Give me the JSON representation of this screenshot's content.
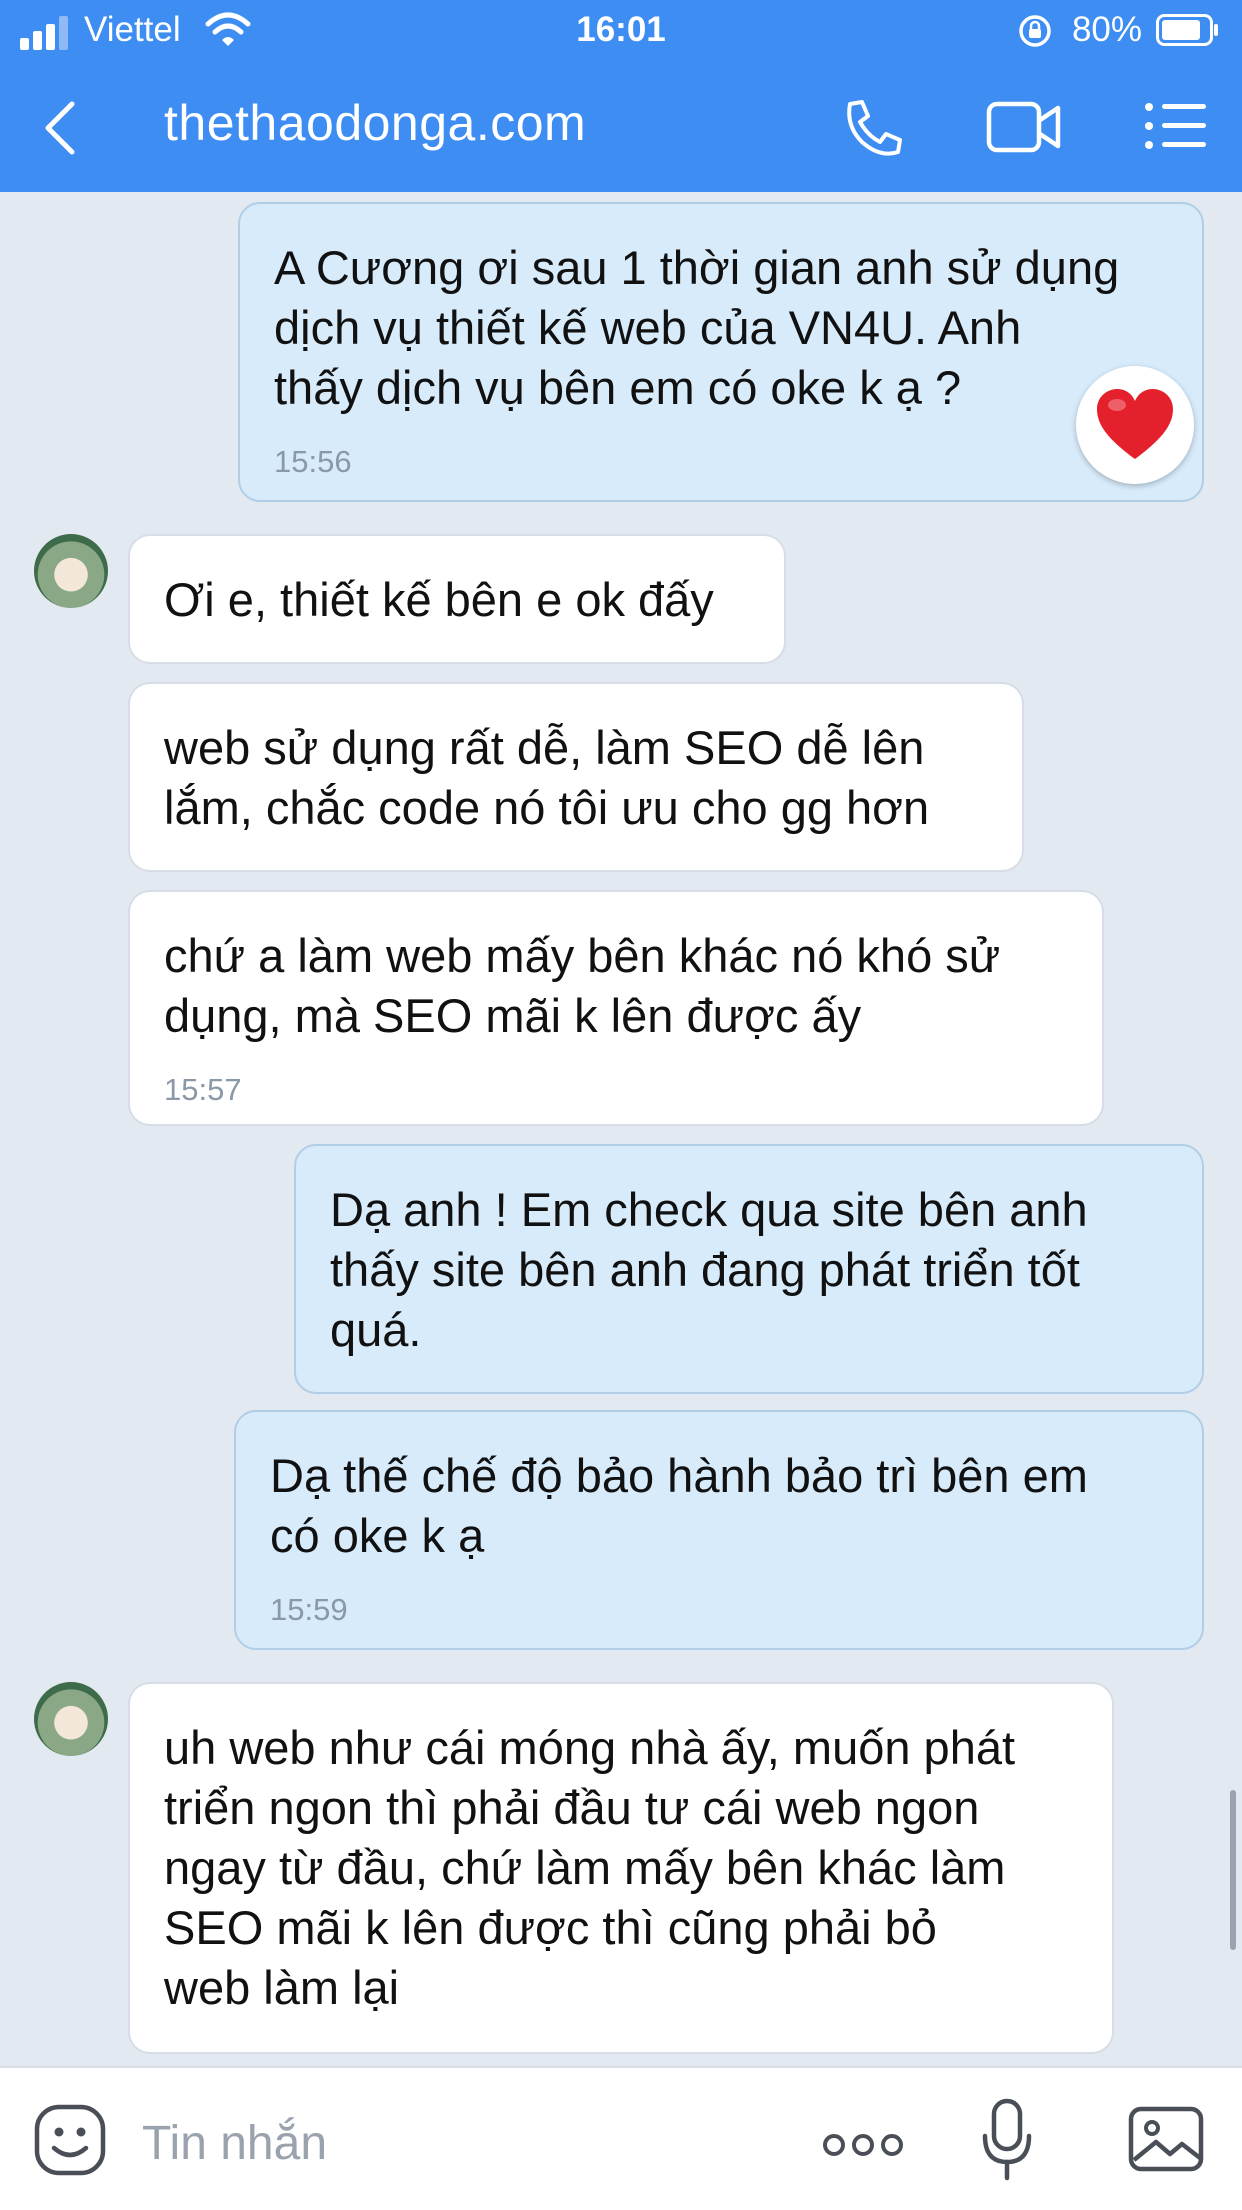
{
  "status_bar": {
    "carrier": "Viettel",
    "time": "16:01",
    "battery": "80%"
  },
  "header": {
    "title": "thethaodonga.com"
  },
  "messages": [
    {
      "dir": "out",
      "text": "A Cương ơi sau 1 thời gian anh sử dụng\ndịch vụ thiết kế web của VN4U. Anh\nthấy dịch vụ bên em có oke k ạ ?",
      "time": "15:56",
      "reaction": "heart"
    },
    {
      "dir": "in",
      "text": "Ơi e, thiết kế bên e ok đấy",
      "time": ""
    },
    {
      "dir": "in",
      "text": "web sử dụng rất dễ, làm SEO dễ lên\nlắm, chắc code nó tôi ưu cho gg hơn",
      "time": ""
    },
    {
      "dir": "in",
      "text": "chứ a làm web mấy bên khác nó khó sử\ndụng, mà SEO mãi k lên được ấy",
      "time": "15:57"
    },
    {
      "dir": "out",
      "text": "Dạ anh ! Em check qua site bên anh\nthấy site bên anh đang phát triển tốt\nquá.",
      "time": ""
    },
    {
      "dir": "out",
      "text": "Dạ thế chế độ bảo hành bảo trì bên em\ncó oke k ạ",
      "time": "15:59"
    },
    {
      "dir": "in",
      "text": "uh web như cái móng nhà ấy, muốn phát\ntriển ngon thì phải đầu tư cái web ngon\nngay từ đầu, chứ làm mấy bên khác làm\nSEO mãi k lên được thì cũng phải bỏ\nweb làm lại",
      "time": ""
    }
  ],
  "input": {
    "placeholder": "Tin nhắn"
  },
  "colors": {
    "header": "#3d8df3",
    "background": "#e2e9f1",
    "outgoing_bubble": "#d7ebfb",
    "incoming_bubble": "#ffffff",
    "reaction_heart": "#e3202c"
  },
  "icons": {
    "back": "chevron-left-icon",
    "call": "phone-icon",
    "video": "video-camera-icon",
    "menu": "list-menu-icon",
    "sticker": "emoji-icon",
    "more": "more-dots-icon",
    "mic": "microphone-icon",
    "image": "image-icon"
  }
}
